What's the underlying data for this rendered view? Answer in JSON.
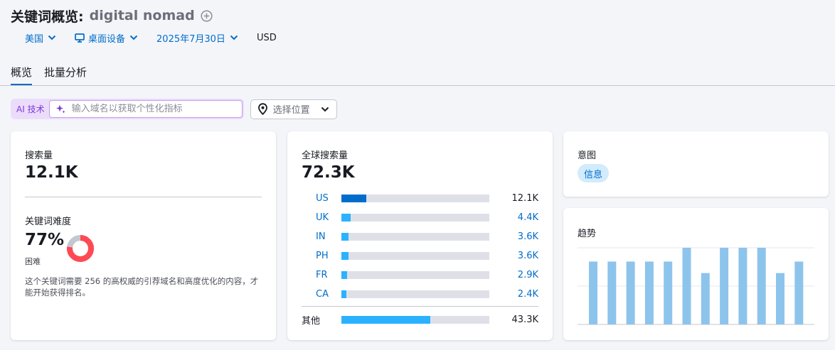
{
  "header": {
    "title_prefix": "关键词概览:",
    "keyword": "digital nomad",
    "add_icon": "plus-circle-icon"
  },
  "filters": {
    "country": "美国",
    "device": "桌面设备",
    "device_icon": "desktop-icon",
    "date": "2025年7月30日",
    "currency": "USD"
  },
  "tabs": [
    {
      "label": "概览",
      "active": true
    },
    {
      "label": "批量分析",
      "active": false
    }
  ],
  "ai": {
    "badge": "AI 技术",
    "placeholder": "输入域名以获取个性化指标",
    "icon": "sparkle-icon"
  },
  "location": {
    "label": "选择位置",
    "icon": "map-pin-icon"
  },
  "search_volume": {
    "label": "搜索量",
    "value": "12.1K"
  },
  "keyword_difficulty": {
    "label": "关键词难度",
    "value": "77%",
    "percent": 77,
    "level": "困难",
    "description": "这个关键词需要 256 的高权威的引荐域名和高度优化的内容，才能开始获得排名。",
    "color": "#ff4953"
  },
  "global_volume": {
    "label": "全球搜索量",
    "value": "72.3K",
    "countries": [
      {
        "code": "US",
        "value": "12.1K",
        "share": 0.167,
        "color": "#006dca"
      },
      {
        "code": "UK",
        "value": "4.4K",
        "share": 0.061,
        "color": "#2bb2ff"
      },
      {
        "code": "IN",
        "value": "3.6K",
        "share": 0.05,
        "color": "#2bb2ff"
      },
      {
        "code": "PH",
        "value": "3.6K",
        "share": 0.05,
        "color": "#2bb2ff"
      },
      {
        "code": "FR",
        "value": "2.9K",
        "share": 0.04,
        "color": "#2bb2ff"
      },
      {
        "code": "CA",
        "value": "2.4K",
        "share": 0.033,
        "color": "#2bb2ff"
      }
    ],
    "other": {
      "label": "其他",
      "value": "43.3K",
      "share": 0.599,
      "color": "#2bb2ff"
    }
  },
  "intent": {
    "label": "意图",
    "badge": "信息"
  },
  "trend": {
    "label": "趋势",
    "values": [
      0.82,
      0.82,
      0.82,
      0.82,
      0.82,
      1.0,
      0.67,
      1.0,
      1.0,
      1.0,
      0.67,
      0.82
    ],
    "color": "#8dc4ec"
  }
}
